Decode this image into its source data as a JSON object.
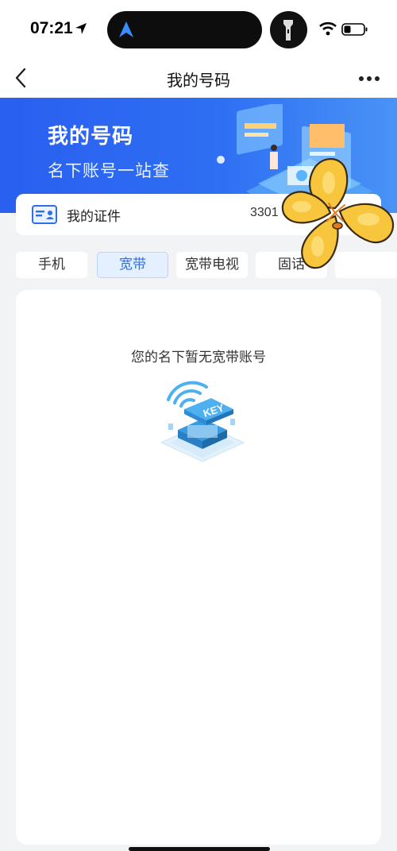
{
  "status_bar": {
    "time": "07:21"
  },
  "header": {
    "title": "我的号码"
  },
  "banner": {
    "title": "我的号码",
    "subtitle": "名下账号一站查"
  },
  "id_card": {
    "label": "我的证件",
    "number": "3301"
  },
  "tabs": [
    {
      "label": "手机",
      "active": false
    },
    {
      "label": "宽带",
      "active": true
    },
    {
      "label": "宽带电视",
      "active": false
    },
    {
      "label": "固话",
      "active": false
    },
    {
      "label": "",
      "active": false
    }
  ],
  "content": {
    "empty_message": "您的名下暂无宽带账号",
    "illustration_text": "KEY"
  },
  "colors": {
    "brand_blue": "#2e6ff3",
    "active_tab_bg": "#e4efff",
    "active_tab_text": "#2f6fe8",
    "sticker_yellow": "#f7c63c"
  },
  "icons": [
    "location-arrow-icon",
    "navigation-arrow-icon",
    "flashlight-icon",
    "wifi-icon",
    "battery-icon",
    "back-chevron-icon",
    "more-dots-icon",
    "id-card-icon",
    "flower-sticker"
  ]
}
